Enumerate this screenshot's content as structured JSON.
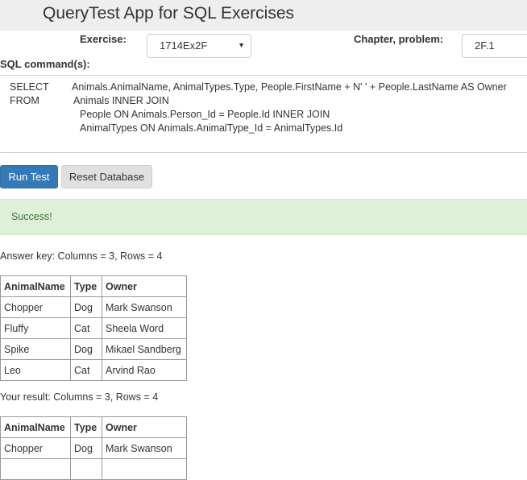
{
  "app": {
    "title": "QueryTest App for SQL Exercises"
  },
  "form": {
    "exercise_label": "Exercise:",
    "exercise_value": "1714Ex2F",
    "chapter_label": "Chapter, problem:",
    "chapter_value": "2F.1",
    "sql_label": "SQL command(s):"
  },
  "sql": {
    "lines": [
      {
        "keyword": "SELECT",
        "text": "Animals.AnimalName, AnimalTypes.Type, People.FirstName + N' ' + People.LastName AS Owner"
      },
      {
        "keyword": "FROM",
        "text": "Animals INNER JOIN"
      },
      {
        "keyword": "",
        "text": "People ON Animals.Person_Id = People.Id INNER JOIN"
      },
      {
        "keyword": "",
        "text": "AnimalTypes ON Animals.AnimalType_Id = AnimalTypes.Id"
      }
    ]
  },
  "buttons": {
    "run": "Run Test",
    "reset": "Reset Database"
  },
  "alert": {
    "text": "Success!"
  },
  "answer_key": {
    "summary": "Answer key: Columns = 3, Rows = 4",
    "columns": [
      "AnimalName",
      "Type",
      "Owner"
    ],
    "rows": [
      [
        "Chopper",
        "Dog",
        "Mark Swanson"
      ],
      [
        "Fluffy",
        "Cat",
        "Sheela Word"
      ],
      [
        "Spike",
        "Dog",
        "Mikael Sandberg"
      ],
      [
        "Leo",
        "Cat",
        "Arvind Rao"
      ]
    ]
  },
  "your_result": {
    "summary": "Your result: Columns = 3, Rows = 4",
    "columns": [
      "AnimalName",
      "Type",
      "Owner"
    ],
    "rows": [
      [
        "Chopper",
        "Dog",
        "Mark Swanson"
      ],
      [
        "",
        "",
        ""
      ]
    ]
  },
  "colors": {
    "primary": "#337ab7",
    "success_bg": "#dff0d8",
    "success_text": "#3c763d",
    "header_bg": "#eeeeee"
  }
}
